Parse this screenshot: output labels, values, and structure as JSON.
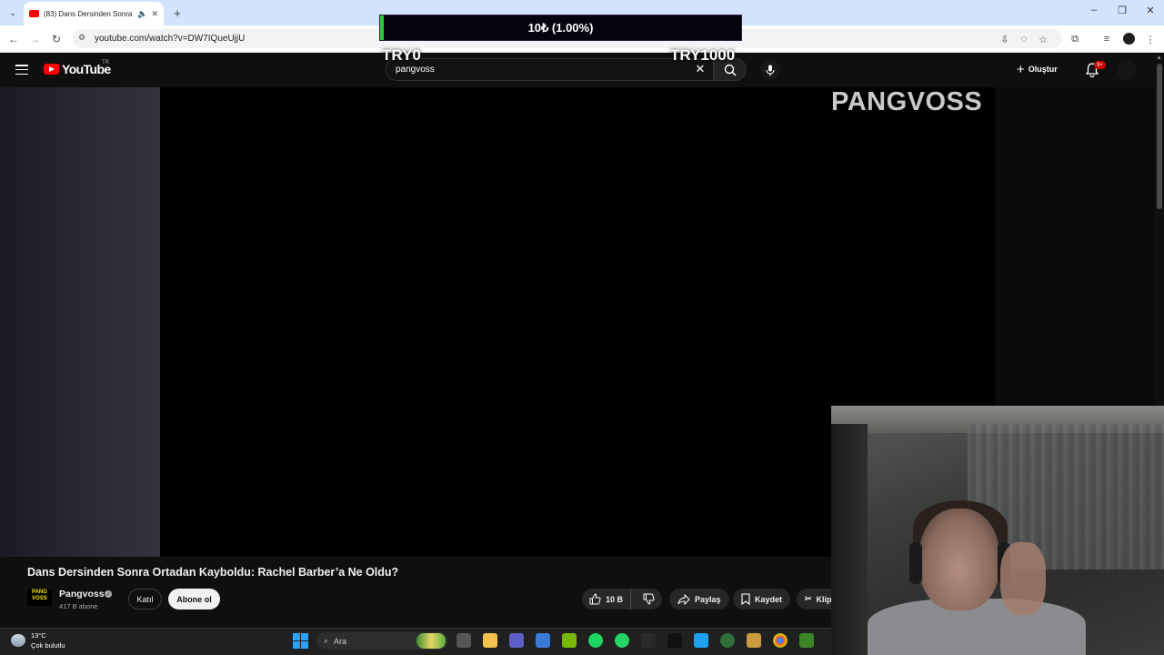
{
  "browser": {
    "tab": {
      "title": "(83) Dans Dersinden Sonra",
      "audio_icon": "speaker-icon",
      "close_icon": "close-icon"
    },
    "url": "youtube.com/watch?v=DW7IQueUjjU"
  },
  "youtube": {
    "logo_text": "YouTube",
    "country": "TR",
    "search_value": "pangvoss",
    "create_label": "Oluştur",
    "notification_badge": "9+"
  },
  "overlay": {
    "progress_text": "10₺ (1.00%)",
    "progress_fraction": 0.01,
    "min_label": "TRY0",
    "max_label": "TRY1000",
    "progress_color": "#31c93b"
  },
  "video": {
    "brand_text": "PANGVOSS",
    "title": "Dans Dersinden Sonra Ortadan Kayboldu: Rachel Barber’a Ne Oldu?"
  },
  "channel": {
    "avatar_text": "PANG VOSS",
    "name": "Pangvoss",
    "subs": "417 B abone",
    "join_label": "Katıl",
    "subscribe_label": "Abone ol"
  },
  "actions": {
    "likes": "10 B",
    "share": "Paylaş",
    "save": "Kaydet",
    "clip": "Klip"
  },
  "taskbar": {
    "temp": "13°C",
    "weather": "Çok bulutlu",
    "search_placeholder": "Ara"
  },
  "colors": {
    "yt_red": "#ff0000",
    "chrome_blue": "#d3e3fd",
    "dark_bg": "#0f0f0f"
  }
}
